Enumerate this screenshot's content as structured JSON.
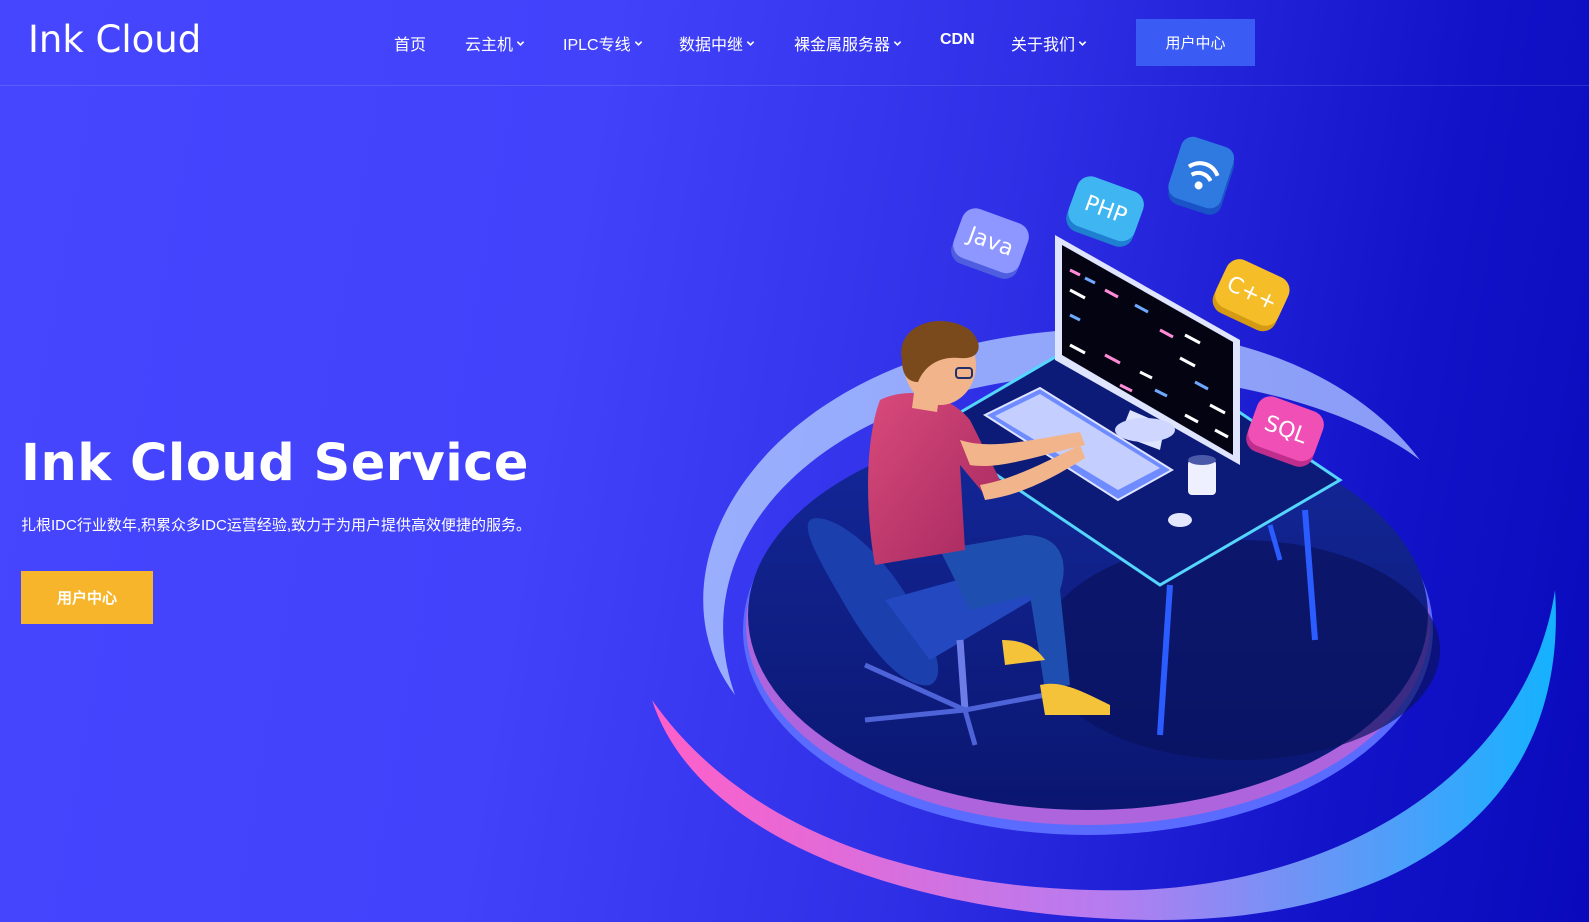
{
  "header": {
    "logo": "Ink Cloud",
    "nav": [
      {
        "label": "首页",
        "has_dropdown": false
      },
      {
        "label": "云主机",
        "has_dropdown": true
      },
      {
        "label": "IPLC专线",
        "has_dropdown": true
      },
      {
        "label": "数据中继",
        "has_dropdown": true
      },
      {
        "label": "裸金属服务器",
        "has_dropdown": true
      },
      {
        "label": "CDN",
        "has_dropdown": false
      },
      {
        "label": "关于我们",
        "has_dropdown": true
      }
    ],
    "user_center": "用户中心"
  },
  "hero": {
    "title": "Ink Cloud Service",
    "subtitle": "扎根IDC行业数年,积累众多IDC运营经验,致力于为用户提供高效便捷的服务。",
    "button": "用户中心"
  },
  "illustration": {
    "badges": [
      "Java",
      "PHP",
      "C++",
      "SQL"
    ],
    "icons": [
      "wifi-icon"
    ]
  },
  "colors": {
    "background_start": "#4646ff",
    "background_end": "#0a0abc",
    "top_button": "#3a5cf5",
    "hero_button": "#f7b52c"
  }
}
